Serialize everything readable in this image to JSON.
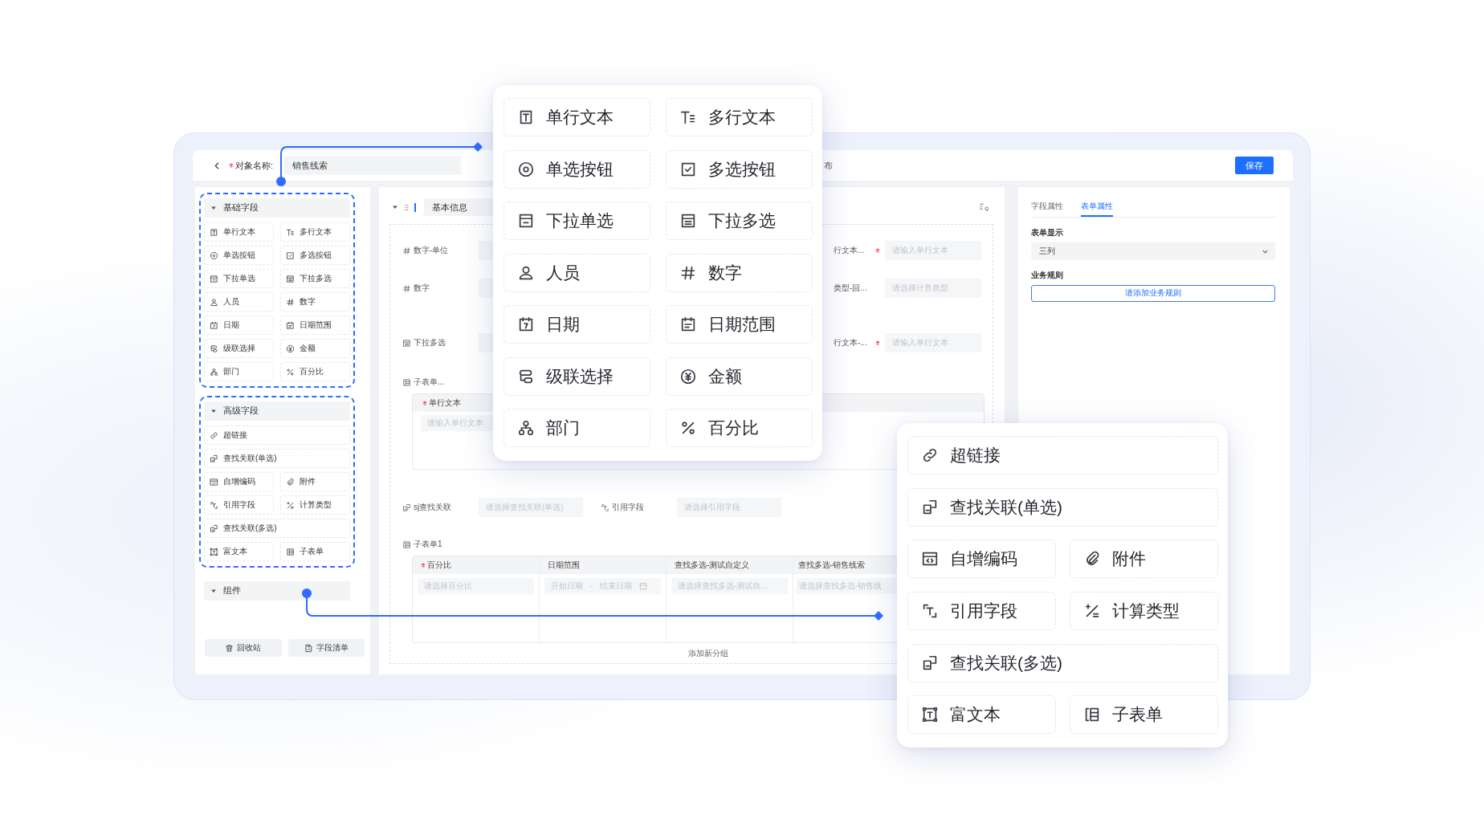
{
  "top_bar": {
    "required": true,
    "object_name_label": "对象名称:",
    "object_name_value": "销售线索",
    "publish_label": "布",
    "save_button": "保存"
  },
  "field_palette": {
    "groups": [
      {
        "title": "基础字段",
        "expanded": true,
        "highlighted": true,
        "items": [
          {
            "kind": "single-text",
            "label": "单行文本",
            "wide": false
          },
          {
            "kind": "multi-text",
            "label": "多行文本",
            "wide": false
          },
          {
            "kind": "radio",
            "label": "单选按钮",
            "wide": false
          },
          {
            "kind": "checkbox",
            "label": "多选按钮",
            "wide": false
          },
          {
            "kind": "dropdown-single",
            "label": "下拉单选",
            "wide": false
          },
          {
            "kind": "dropdown-multi",
            "label": "下拉多选",
            "wide": false
          },
          {
            "kind": "person",
            "label": "人员",
            "wide": false
          },
          {
            "kind": "number",
            "label": "数字",
            "wide": false
          },
          {
            "kind": "date",
            "label": "日期",
            "wide": false
          },
          {
            "kind": "date-range",
            "label": "日期范围",
            "wide": false
          },
          {
            "kind": "cascade",
            "label": "级联选择",
            "wide": false
          },
          {
            "kind": "amount",
            "label": "金额",
            "wide": false
          },
          {
            "kind": "department",
            "label": "部门",
            "wide": false
          },
          {
            "kind": "percent",
            "label": "百分比",
            "wide": false
          }
        ]
      },
      {
        "title": "高级字段",
        "expanded": true,
        "highlighted": true,
        "items": [
          {
            "kind": "link",
            "label": "超链接",
            "wide": true
          },
          {
            "kind": "lookup",
            "label": "查找关联(单选)",
            "wide": true
          },
          {
            "kind": "autonumber",
            "label": "自增编码",
            "wide": false
          },
          {
            "kind": "attachment",
            "label": "附件",
            "wide": false
          },
          {
            "kind": "reference",
            "label": "引用字段",
            "wide": false
          },
          {
            "kind": "formula",
            "label": "计算类型",
            "wide": false
          },
          {
            "kind": "lookup",
            "label": "查找关联(多选)",
            "wide": true
          },
          {
            "kind": "rich-text",
            "label": "富文本",
            "wide": false
          },
          {
            "kind": "subform",
            "label": "子表单",
            "wide": false
          }
        ]
      },
      {
        "title": "组件",
        "expanded": true,
        "highlighted": false
      }
    ],
    "footer_buttons": [
      {
        "kind": "trash",
        "label": "回收站"
      },
      {
        "kind": "document",
        "label": "字段清单"
      }
    ]
  },
  "form_canvas": {
    "section": {
      "title": "基本信息",
      "expanded": true
    },
    "fields": [
      {
        "kind": "number",
        "label": "数字-单位"
      },
      {
        "kind": "number",
        "label": "数字"
      },
      {
        "kind": "dropdown-multi",
        "label": "下拉多选"
      }
    ],
    "right_fields": [
      {
        "label": "行文本...",
        "required": true,
        "placeholder": "请输入单行文本"
      },
      {
        "label": "类型-回...",
        "required": false,
        "placeholder": "请选择计算类型"
      },
      {
        "label": "行文本-...",
        "required": true,
        "placeholder": "请输入单行文本"
      }
    ],
    "subform": {
      "kind": "subform",
      "label": "子表单...",
      "column": {
        "label": "单行文本",
        "required": true,
        "placeholder": "请输入单行文本"
      }
    },
    "lookup_row": [
      {
        "kind": "lookup",
        "label": "sj查找关联",
        "placeholder": "请选择查找关联(单选)"
      },
      {
        "kind": "reference",
        "label": "引用字段",
        "placeholder": "请选择引用字段"
      }
    ],
    "subform_table": {
      "kind": "subform",
      "label": "子表单1",
      "columns": [
        {
          "kind": "text",
          "label": "百分比",
          "required": true,
          "placeholder": "请选择百分比"
        },
        {
          "kind": "date-range",
          "label": "日期范围",
          "required": false,
          "start_placeholder": "开始日期",
          "separator": "-",
          "end_placeholder": "结束日期"
        },
        {
          "kind": "text",
          "label": "查找多选-测试自定义",
          "required": false,
          "placeholder": "请选择查找多选-测试自..."
        },
        {
          "kind": "text",
          "label": "查找多选-销售线索",
          "required": false,
          "placeholder": "请选择查找多选-销售线"
        }
      ]
    },
    "add_group_button": "添加新分组"
  },
  "properties_panel": {
    "tabs": [
      {
        "label": "字段属性",
        "selected": false
      },
      {
        "label": "表单属性",
        "selected": true
      }
    ],
    "display_label": "表单显示",
    "display_value": "三列",
    "rule_label": "业务规则",
    "rule_button": "请添加业务规则"
  },
  "basic_popup": {
    "items": [
      {
        "kind": "single-text",
        "label": "单行文本",
        "wide": false
      },
      {
        "kind": "multi-text",
        "label": "多行文本",
        "wide": false
      },
      {
        "kind": "radio",
        "label": "单选按钮",
        "wide": false
      },
      {
        "kind": "checkbox",
        "label": "多选按钮",
        "wide": false
      },
      {
        "kind": "dropdown-single",
        "label": "下拉单选",
        "wide": false
      },
      {
        "kind": "dropdown-multi",
        "label": "下拉多选",
        "wide": false
      },
      {
        "kind": "person",
        "label": "人员",
        "wide": false
      },
      {
        "kind": "number",
        "label": "数字",
        "wide": false
      },
      {
        "kind": "date",
        "label": "日期",
        "wide": false
      },
      {
        "kind": "date-range",
        "label": "日期范围",
        "wide": false
      },
      {
        "kind": "cascade",
        "label": "级联选择",
        "wide": false
      },
      {
        "kind": "amount",
        "label": "金额",
        "wide": false
      },
      {
        "kind": "department",
        "label": "部门",
        "wide": false
      },
      {
        "kind": "percent",
        "label": "百分比",
        "wide": false
      }
    ]
  },
  "advanced_popup": {
    "items": [
      {
        "kind": "link",
        "label": "超链接",
        "wide": true
      },
      {
        "kind": "lookup",
        "label": "查找关联(单选)",
        "wide": true
      },
      {
        "kind": "autonumber",
        "label": "自增编码",
        "wide": false
      },
      {
        "kind": "attachment",
        "label": "附件",
        "wide": false
      },
      {
        "kind": "reference",
        "label": "引用字段",
        "wide": false
      },
      {
        "kind": "formula",
        "label": "计算类型",
        "wide": false
      },
      {
        "kind": "lookup",
        "label": "查找关联(多选)",
        "wide": true
      },
      {
        "kind": "rich-text",
        "label": "富文本",
        "wide": false
      },
      {
        "kind": "subform",
        "label": "子表单",
        "wide": false
      }
    ]
  }
}
